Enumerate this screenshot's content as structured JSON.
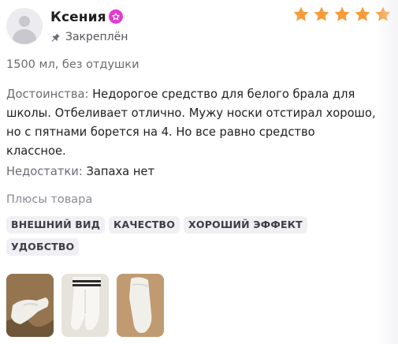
{
  "review": {
    "author": {
      "name": "Ксения",
      "avatar_icon": "user-avatar-placeholder-icon",
      "badge_icon": "pink-star-badge-icon"
    },
    "pinned_label": "Закреплён",
    "pin_icon": "pin-icon",
    "rating": 5,
    "rating_max": 5,
    "star_color": "#f69c3a",
    "variant": "1500 мл, без отдушки",
    "pros_label": "Достоинства:",
    "pros_text": "Недорогое средство для белого брала для школы. Отбеливает отлично. Мужу носки отстирал хорошо, но с пятнами борется на 4. Но все равно средство классное.",
    "cons_label": "Недостатки:",
    "cons_text": "Запаха нет",
    "tags_title": "Плюсы товара",
    "tags": [
      "ВНЕШНИЙ ВИД",
      "КАЧЕСТВО",
      "ХОРОШИЙ ЭФФЕКТ",
      "УДОБСТВО"
    ],
    "photos": [
      "socks-photo-1",
      "socks-photo-2",
      "socks-photo-3"
    ]
  },
  "colors": {
    "badge": "#e23ad0",
    "tag_bg": "#f0eff3",
    "muted_text": "#6b6b73"
  }
}
